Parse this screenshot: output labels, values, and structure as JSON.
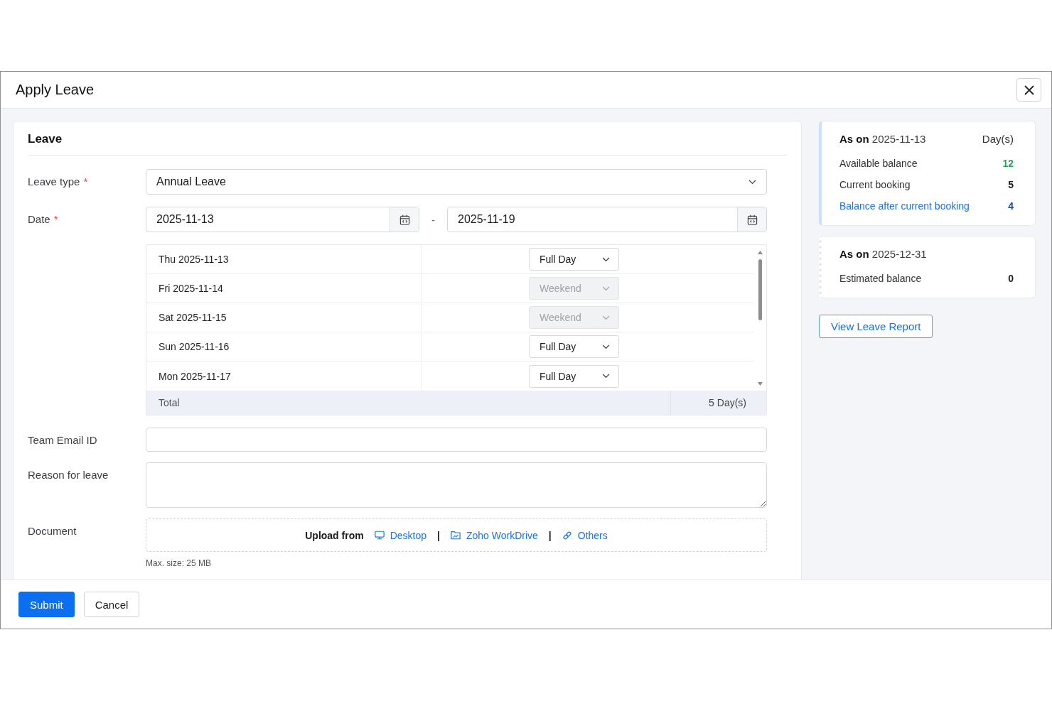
{
  "dialog": {
    "title": "Apply Leave"
  },
  "form": {
    "section_title": "Leave",
    "leave_type": {
      "label": "Leave type",
      "required_mark": "*",
      "value": "Annual Leave"
    },
    "date": {
      "label": "Date",
      "required_mark": "*",
      "from": "2025-11-13",
      "separator": "-",
      "to": "2025-11-19"
    },
    "day_table": {
      "rows": [
        {
          "date": "Thu 2025-11-13",
          "session": "Full Day",
          "disabled": false
        },
        {
          "date": "Fri 2025-11-14",
          "session": "Weekend",
          "disabled": true
        },
        {
          "date": "Sat 2025-11-15",
          "session": "Weekend",
          "disabled": true
        },
        {
          "date": "Sun 2025-11-16",
          "session": "Full Day",
          "disabled": false
        },
        {
          "date": "Mon 2025-11-17",
          "session": "Full Day",
          "disabled": false
        }
      ],
      "total_label": "Total",
      "total_value": "5 Day(s)"
    },
    "team_email": {
      "label": "Team Email ID"
    },
    "reason": {
      "label": "Reason for leave"
    },
    "document": {
      "label": "Document",
      "upload_label": "Upload from",
      "items": [
        {
          "kind": "desktop",
          "label": "Desktop"
        },
        {
          "kind": "separator",
          "label": "|"
        },
        {
          "kind": "drive",
          "label": "Zoho WorkDrive"
        },
        {
          "kind": "separator",
          "label": "|"
        },
        {
          "kind": "link",
          "label": "Others"
        }
      ],
      "note": "Max. size: 25 MB"
    }
  },
  "balance_cards": [
    {
      "heading": "**As on** 2025-11-13",
      "unit": "Day(s)",
      "highlighted": true,
      "rows": [
        {
          "label": "Available balance",
          "value": "12",
          "kind": "positive"
        },
        {
          "label": "Current booking",
          "value": "5",
          "kind": "plain"
        },
        {
          "label": "Balance after current booking",
          "value": "4",
          "kind": "result"
        }
      ]
    },
    {
      "heading": "**As on** 2025-12-31",
      "highlighted": false,
      "rows": [
        {
          "label": "Estimated balance",
          "value": "0",
          "kind": "plain"
        }
      ]
    }
  ],
  "report_button": "View Leave Report",
  "footer_buttons": [
    {
      "label": "Submit",
      "kind": "primary"
    },
    {
      "label": "Cancel",
      "kind": "secondary"
    }
  ]
}
